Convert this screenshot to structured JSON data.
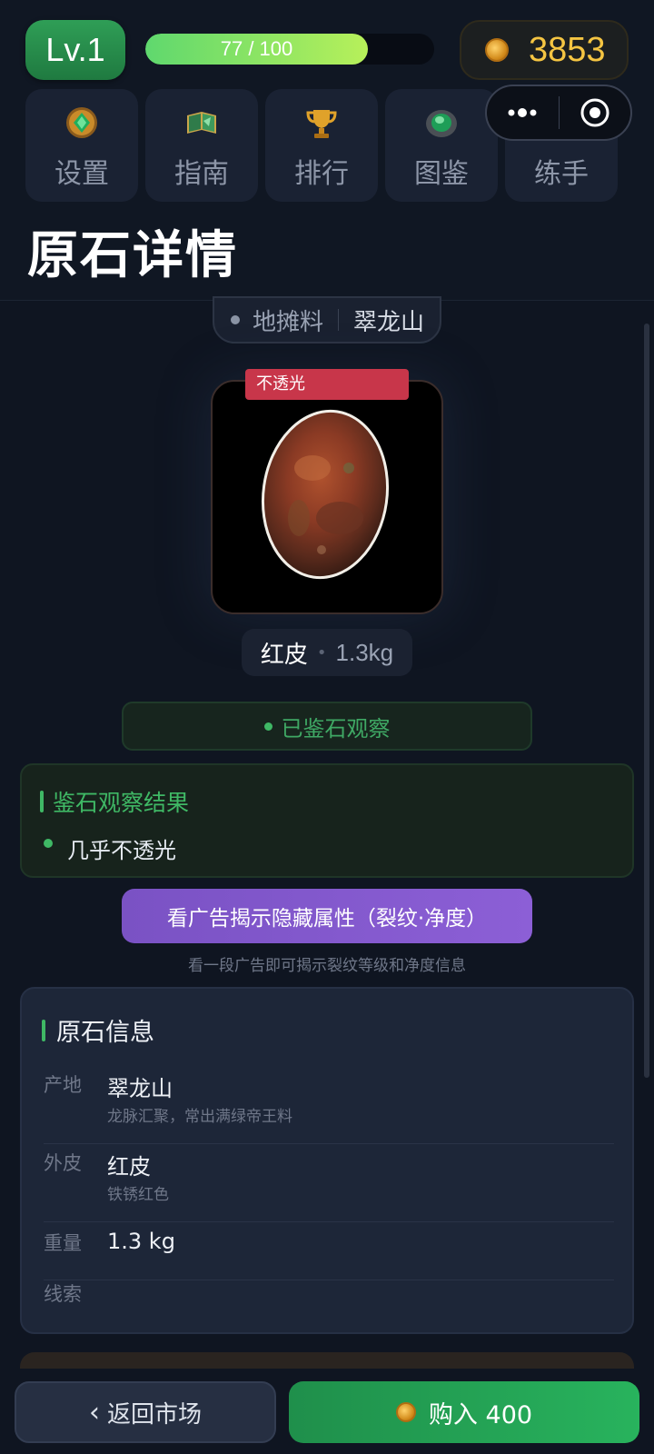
{
  "header": {
    "level_label": "Lv.1",
    "xp_text": "77 / 100",
    "xp_current": 77,
    "xp_max": 100,
    "coins": "3853"
  },
  "nav": {
    "items": [
      {
        "label": "设置",
        "icon": "gem-medallion-icon"
      },
      {
        "label": "指南",
        "icon": "book-icon"
      },
      {
        "label": "排行",
        "icon": "trophy-icon"
      },
      {
        "label": "图鉴",
        "icon": "jade-stone-icon"
      },
      {
        "label": "练手",
        "icon": "tool-icon"
      }
    ]
  },
  "page": {
    "title": "原石详情"
  },
  "stone": {
    "category": "地摊料",
    "origin": "翠龙山",
    "tag": "不透光",
    "skin": "红皮",
    "weight": "1.3kg",
    "observed_label": "已鉴石观察"
  },
  "observation": {
    "title": "鉴石观察结果",
    "items": [
      "几乎不透光"
    ]
  },
  "ad": {
    "button_label": "看广告揭示隐藏属性（裂纹·净度）",
    "hint": "看一段广告即可揭示裂纹等级和净度信息"
  },
  "info": {
    "title": "原石信息",
    "rows": [
      {
        "key": "产地",
        "value": "翠龙山",
        "desc": "龙脉汇聚，常出满绿帝王料"
      },
      {
        "key": "外皮",
        "value": "红皮",
        "desc": "铁锈红色"
      },
      {
        "key": "重量",
        "value": "1.3 kg",
        "desc": ""
      },
      {
        "key": "线索",
        "value": "",
        "desc": ""
      }
    ]
  },
  "bottom": {
    "back_label": "返回市场",
    "buy_label": "购入 400"
  },
  "colors": {
    "accent_green": "#3fb865",
    "coin_gold": "#f5c542",
    "tag_red": "#c8364a",
    "ad_purple": "#7a52c4"
  }
}
